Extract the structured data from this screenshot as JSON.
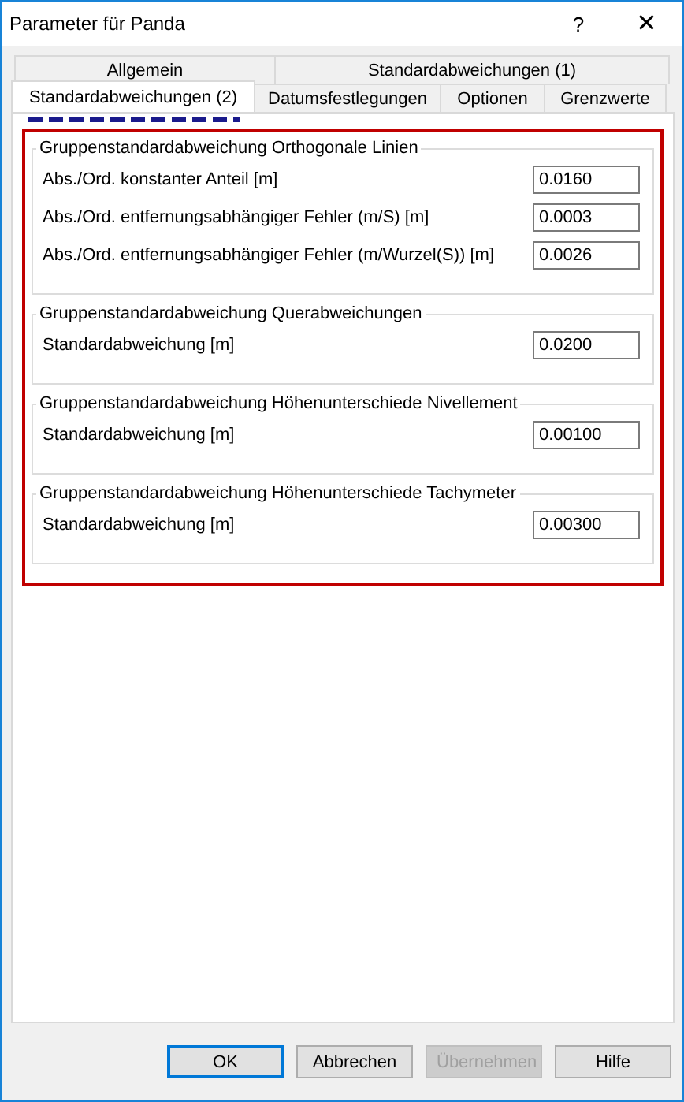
{
  "window": {
    "title": "Parameter für Panda",
    "help": "?",
    "close": "✕"
  },
  "tab_rows": [
    [
      {
        "label": "Allgemein",
        "selected": false
      },
      {
        "label": "Standardabweichungen (1)",
        "selected": false
      }
    ],
    [
      {
        "label": "Standardabweichungen (2)",
        "selected": true
      },
      {
        "label": "Datumsfestlegungen",
        "selected": false
      },
      {
        "label": "Optionen",
        "selected": false
      },
      {
        "label": "Grenzwerte",
        "selected": false
      }
    ]
  ],
  "groups": [
    {
      "title": "Gruppenstandardabweichung Orthogonale Linien",
      "fields": [
        {
          "label": "Abs./Ord. konstanter Anteil [m]",
          "value": "0.0160"
        },
        {
          "label": "Abs./Ord. entfernungsabhängiger Fehler (m/S) [m]",
          "value": "0.0003"
        },
        {
          "label": "Abs./Ord. entfernungsabhängiger Fehler (m/Wurzel(S)) [m]",
          "value": "0.0026"
        }
      ]
    },
    {
      "title": "Gruppenstandardabweichung Querabweichungen",
      "fields": [
        {
          "label": "Standardabweichung [m]",
          "value": "0.0200"
        }
      ]
    },
    {
      "title": "Gruppenstandardabweichung Höhenunterschiede Nivellement",
      "fields": [
        {
          "label": "Standardabweichung [m]",
          "value": "0.00100"
        }
      ]
    },
    {
      "title": "Gruppenstandardabweichung Höhenunterschiede Tachymeter",
      "fields": [
        {
          "label": "Standardabweichung [m]",
          "value": "0.00300"
        }
      ]
    }
  ],
  "buttons": [
    {
      "label": "OK",
      "default": true,
      "disabled": false
    },
    {
      "label": "Abbrechen",
      "default": false,
      "disabled": false
    },
    {
      "label": "Übernehmen",
      "default": false,
      "disabled": true
    },
    {
      "label": "Hilfe",
      "default": false,
      "disabled": false
    }
  ]
}
